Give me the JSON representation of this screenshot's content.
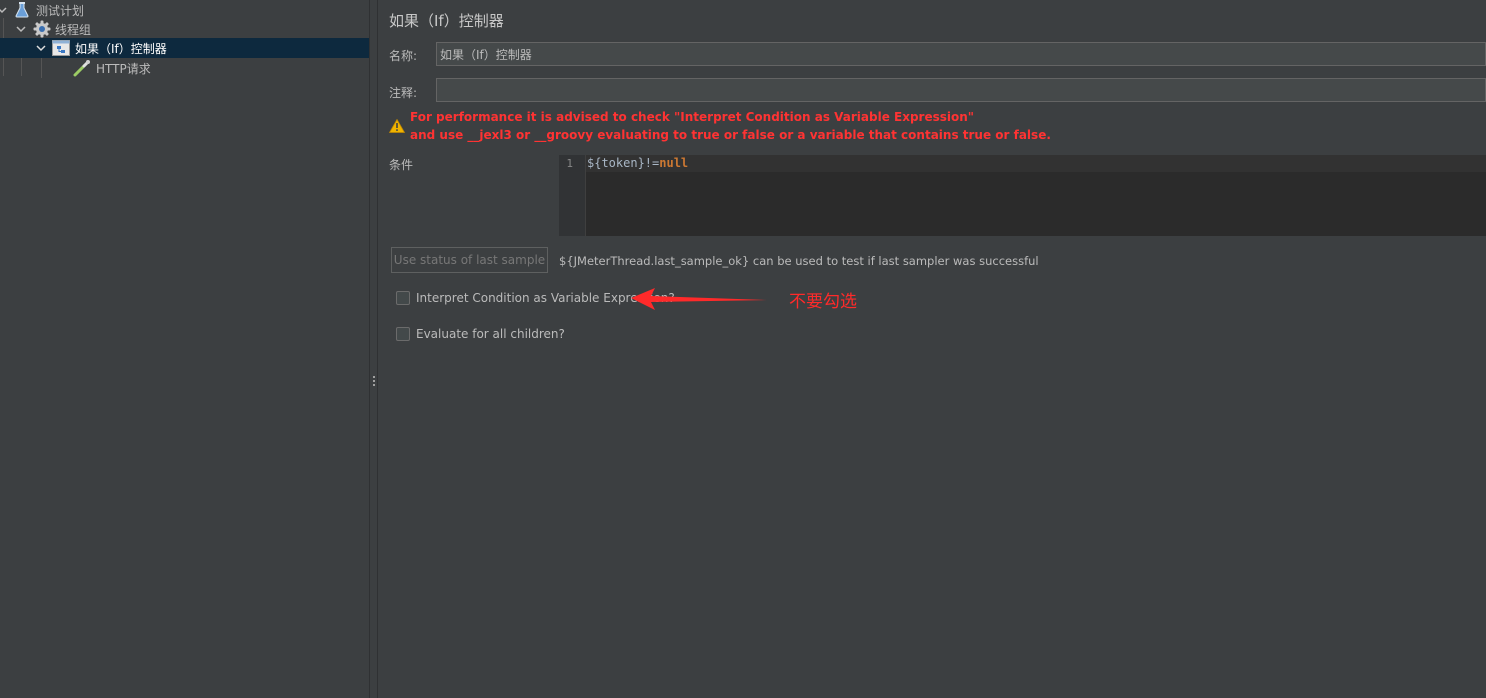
{
  "tree": {
    "items": [
      {
        "label": "测试计划",
        "icon": "test-plan-flask-icon"
      },
      {
        "label": "线程组",
        "icon": "thread-group-gear-icon"
      },
      {
        "label": "如果（If）控制器",
        "icon": "if-controller-icon",
        "selected": true
      },
      {
        "label": "HTTP请求",
        "icon": "http-sampler-pipette-icon"
      }
    ]
  },
  "panel": {
    "title": "如果（If）控制器",
    "name_label": "名称:",
    "name_value": "如果（If）控制器",
    "comment_label": "注释:",
    "comment_value": "",
    "warning": {
      "line1": "For performance it is advised to check \"Interpret Condition as Variable Expression\"",
      "line2": "and use __jexl3 or __groovy evaluating to true or false or a variable that contains true or false."
    },
    "condition_label": "条件",
    "editor": {
      "line_number": "1",
      "code_prefix": "${token}!=",
      "code_keyword": "null"
    },
    "use_status_button": "Use status of last sample",
    "use_status_hint": "${JMeterThread.last_sample_ok} can be used to test if last sampler was successful",
    "interpret_checkbox": {
      "label": "Interpret Condition as Variable Expression?",
      "checked": false
    },
    "evaluate_checkbox": {
      "label": "Evaluate for all children?",
      "checked": false
    }
  },
  "annotation": {
    "text": "不要勾选",
    "color": "#ff2a2a"
  },
  "colors": {
    "background": "#3c3f41",
    "selection": "#0d293e",
    "warning_text": "#ff3333",
    "editor_bg": "#2b2b2b",
    "keyword": "#cc7832"
  }
}
